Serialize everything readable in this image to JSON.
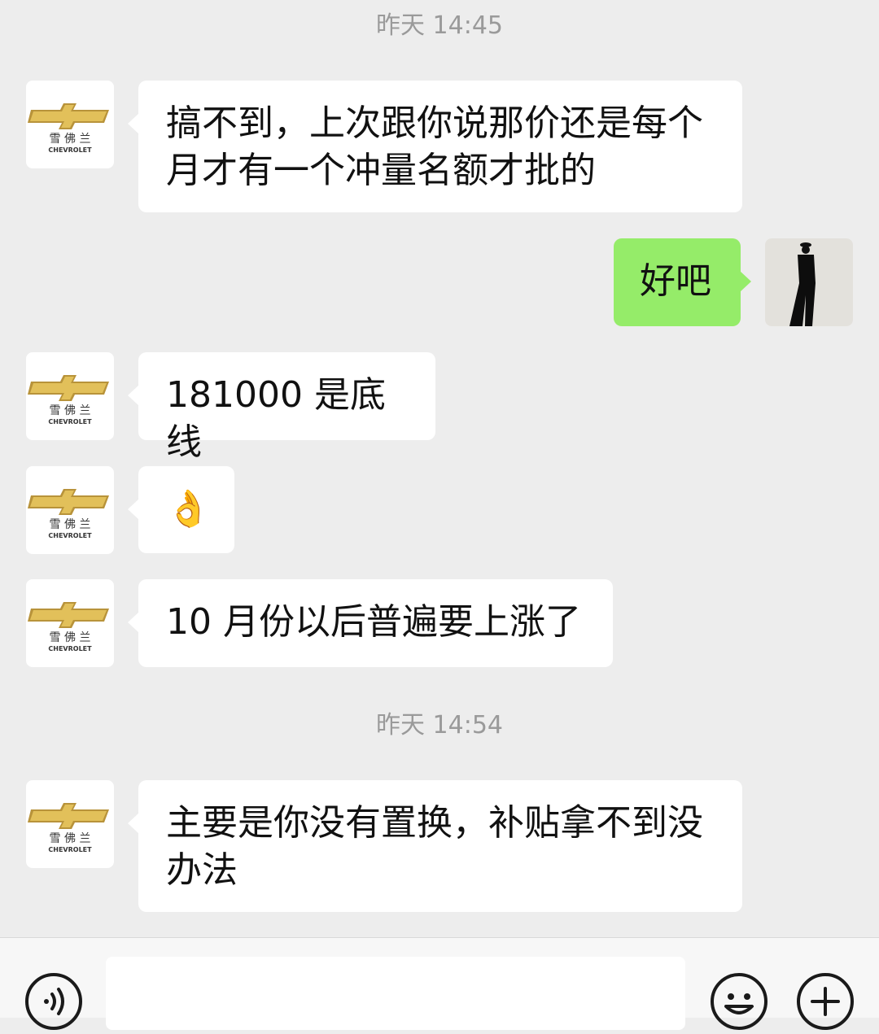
{
  "conversation": {
    "contact_avatar": {
      "brand_cn": "雪佛兰",
      "brand_en": "CHEVROLET",
      "brand_gold": "#d8b24a"
    },
    "messages": [
      {
        "type": "timestamp",
        "text": "昨天 14:45"
      },
      {
        "type": "received",
        "text": "搞不到，上次跟你说那价还是每个月才有一个冲量名额才批的"
      },
      {
        "type": "sent",
        "text": "好吧"
      },
      {
        "type": "received",
        "text": "181000 是底线"
      },
      {
        "type": "received",
        "text": "👌"
      },
      {
        "type": "received",
        "text": "10 月份以后普遍要上涨了"
      },
      {
        "type": "timestamp",
        "text": "昨天 14:54"
      },
      {
        "type": "received",
        "text": "主要是你没有置换，补贴拿不到没办法"
      }
    ]
  },
  "colors": {
    "background": "#ededed",
    "received_bubble": "#ffffff",
    "sent_bubble": "#95ec69",
    "timestamp_text": "#9a9a9a"
  },
  "input_bar": {
    "voice_icon": "voice-icon",
    "message_value": "",
    "emoji_icon": "emoji-face-icon",
    "more_icon": "plus-icon"
  }
}
